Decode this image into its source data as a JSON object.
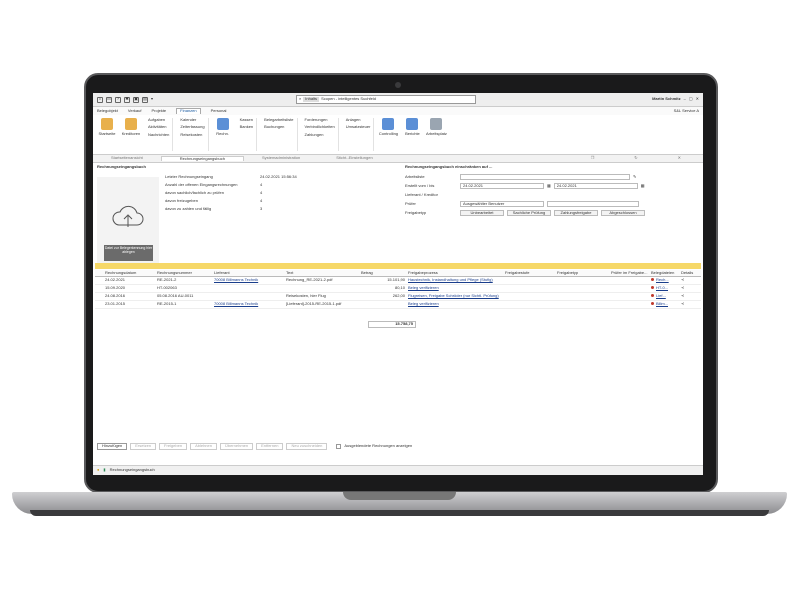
{
  "titlebar": {
    "search_tag": "Inhalts",
    "search_value": "Scopen - intelligentes Suchfeld",
    "user": "Martin Schmitz"
  },
  "menu": {
    "items": [
      "Belegobjekt",
      "Verkauf",
      "Projekte",
      "Finanzen",
      "Personal"
    ],
    "right": "S&L Service A"
  },
  "ribbon": {
    "big1": "Startseite",
    "big2": "Kreditoren",
    "col1": [
      "Aufgaben",
      "Aktivitäten",
      "Nachrichten"
    ],
    "col2": [
      "Kalender",
      "Zeiterfassung",
      "Reisekosten"
    ],
    "big3": "Rechn.",
    "col3": [
      "Kassen",
      "Banken"
    ],
    "col4": [
      "Belegarbeitsliste",
      "Buchungen"
    ],
    "col5": [
      "Forderungen",
      "Verbindlichkeiten",
      "Zahlungen"
    ],
    "col6": [
      "Anlagen",
      "Umsatzsteuer"
    ],
    "big4": "Controlling",
    "big5": "Berichte",
    "big6": "Arbeitsplatz"
  },
  "tabs": [
    "Startseitenansicht",
    "Rechnungseingangsbuch",
    "Systemadministration",
    "Sticht.-Einstellungen"
  ],
  "panel": {
    "title": "Rechnungseingangsbuch",
    "upload_label": "Datei zur Belegerkennung hier ablegen",
    "stats": [
      {
        "label": "Letzter Rechnungseingang",
        "value": "24.02.2021 15:56:34"
      },
      {
        "label": "Anzahl der offenen Eingangsrechnungen",
        "value": "4"
      },
      {
        "label": "davon sachlich/fachlich zu prüfen",
        "value": "4"
      },
      {
        "label": "davon freizugeben",
        "value": "4"
      },
      {
        "label": "davon zu zahlen und fällig",
        "value": "3"
      }
    ]
  },
  "filter": {
    "title": "Rechnungseingangsbuch einschränken auf ...",
    "rows": [
      {
        "label": "Arbeitsliste",
        "value": ""
      },
      {
        "label": "Erstellt vom / bis",
        "from": "24.02.2021",
        "to": "24.02.2021"
      },
      {
        "label": "Lieferant / Kreditor",
        "value": ""
      },
      {
        "label": "Prüfer",
        "value": "Ausgewählter Benutzer"
      }
    ],
    "freigabe_label": "Freigabetyp",
    "freigabe_buttons": [
      "Unbearbeitet",
      "Sachliche Prüfung",
      "Zahlungsfreigabe",
      "Abgeschlossen"
    ]
  },
  "grid": {
    "headers": [
      "Rechnungsdatum",
      "Rechnungsnummer",
      "Lieferant",
      "Text",
      "Betrag",
      "Freigabeprozess",
      "Freigabestufe",
      "Freigabetyp",
      "Prüfer im Freigabe...",
      "Belegdateien",
      "Details"
    ],
    "rows": [
      {
        "date": "24.02.2021",
        "num": "RE-2021-2",
        "supplier": "70008 Billmanns Technik",
        "text": "Rechnung_RE-2021-2.pdf",
        "amount": "15.101,90",
        "process": "Haustechnik, Instandhaltung und Pflege (Stufig)",
        "doc": "Rech..."
      },
      {
        "date": "15.09.2020",
        "num": "HT-002063",
        "supplier": "",
        "text": "",
        "amount": "80,10",
        "process": "Beleg verifizieren",
        "doc": "HT-0..."
      },
      {
        "date": "24.08.2016",
        "num": "05.08.2016 AU-0011",
        "supplier": "",
        "text": "Reisekosten, hier Flug",
        "amount": "262,00",
        "process": "Flugreisen, Freigabe Schröder (nur Sichtl. Prüfung)",
        "doc": "Lief..."
      },
      {
        "date": "23.01.2015",
        "num": "RE-2015-1",
        "supplier": "70008 Billmanns Technik",
        "text": "[Lieferant]-2015-RE-2015-1.pdf",
        "amount": "",
        "process": "Beleg verifizieren",
        "doc": "Billm..."
      }
    ],
    "total": "15.758,75"
  },
  "bottom": {
    "buttons": [
      "Hinzufügen",
      "Ersetzen",
      "Freigeben",
      "Ablehnen",
      "Übernehmen",
      "Entfernen",
      "Neu zuschneiden"
    ],
    "checkbox": "Ausgeblendete Rechnungen anzeigen"
  },
  "status": {
    "text": "Rechnungseingangsbuch"
  }
}
